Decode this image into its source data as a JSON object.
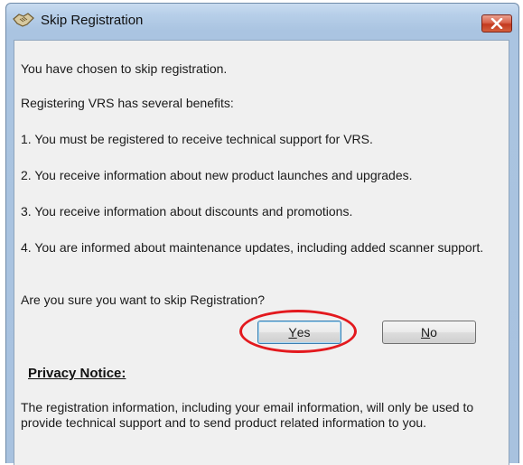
{
  "window": {
    "title": "Skip Registration",
    "icon": "handshake-icon",
    "close_icon": "close-icon"
  },
  "dialog": {
    "line1": "You have chosen to skip registration.",
    "line2": "Registering VRS has several benefits:",
    "benefits": [
      "1. You must be registered to receive technical support for VRS.",
      "2. You receive information about new product launches and upgrades.",
      "3. You receive information about discounts and promotions.",
      "4. You are informed about maintenance updates, including added scanner support."
    ],
    "question": "Are you sure you want to skip Registration?"
  },
  "buttons": {
    "yes_mnemonic": "Y",
    "yes_rest": "es",
    "no_mnemonic": "N",
    "no_rest": "o"
  },
  "privacy": {
    "title": "Privacy Notice:",
    "text": "The registration information, including your email information, will only be used to provide technical support and to send product related information to you."
  },
  "colors": {
    "highlight_ring": "#e3191e",
    "close_button": "#c3391f",
    "titlebar": "#b7cfe9",
    "dialog_background": "#f0f0f0"
  }
}
